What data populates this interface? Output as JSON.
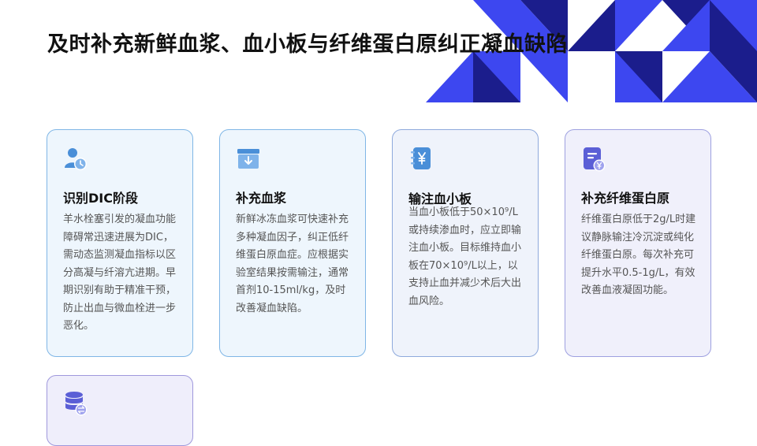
{
  "title": "及时补充新鲜血浆、血小板与纤维蛋白原纠正凝血缺陷",
  "colors": {
    "accent_dark": "#1b1d8c",
    "accent_blue": "#3d47f0",
    "icon_blue": "#4a8fd8",
    "icon_purple": "#5b5fd6"
  },
  "cards": [
    {
      "icon": "user-clock-icon",
      "title": "识别DIC阶段",
      "body": "羊水栓塞引发的凝血功能障碍常迅速进展为DIC，需动态监测凝血指标以区分高凝与纤溶亢进期。早期识别有助于精准干预，防止出血与微血栓进一步恶化。"
    },
    {
      "icon": "box-archive-icon",
      "title": "补充血浆",
      "body": "新鲜冰冻血浆可快速补充多种凝血因子，纠正低纤维蛋白原血症。应根据实验室结果按需输注，通常首剂10-15ml/kg，及时改善凝血缺陷。"
    },
    {
      "icon": "yen-notebook-icon",
      "title": "输注血小板",
      "body": "当血小板低于50×10⁹/L或持续渗血时，应立即输注血小板。目标维持血小板在70×10⁹/L以上，以支持止血并减少术后大出血风险。"
    },
    {
      "icon": "document-yen-icon",
      "title": "补充纤维蛋白原",
      "body": "纤维蛋白原低于2g/L时建议静脉输注冷沉淀或纯化纤维蛋白原。每次补充可提升水平0.5-1g/L，有效改善血液凝固功能。"
    },
    {
      "icon": "database-sync-icon"
    }
  ]
}
